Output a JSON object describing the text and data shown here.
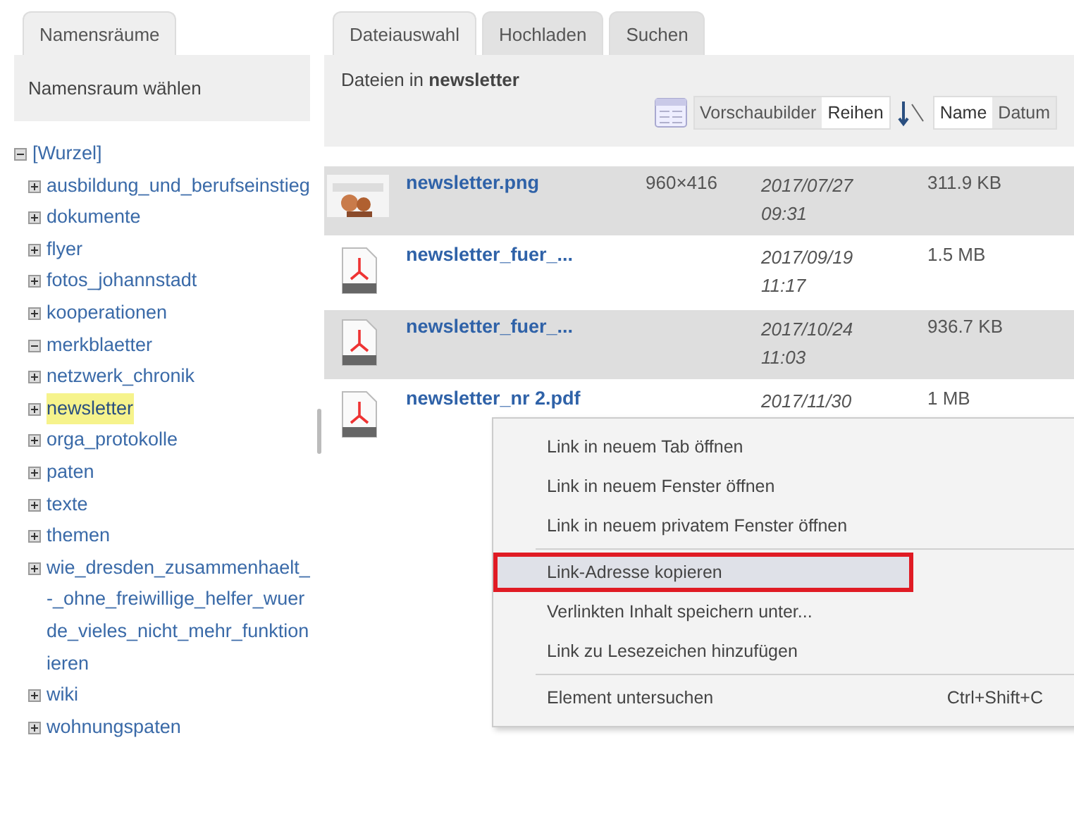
{
  "namespace_panel": {
    "tab": {
      "label": "Namensräume",
      "selected": true
    },
    "heading": "Namensraum wählen",
    "tree": [
      {
        "label": "[Wurzel]",
        "expanded": true,
        "selected": false,
        "children": [
          {
            "label": "ausbildung_und_berufseinstieg",
            "expanded": false,
            "selected": false
          },
          {
            "label": "dokumente",
            "expanded": false,
            "selected": false
          },
          {
            "label": "flyer",
            "expanded": false,
            "selected": false
          },
          {
            "label": "fotos_johannstadt",
            "expanded": false,
            "selected": false
          },
          {
            "label": "kooperationen",
            "expanded": false,
            "selected": false
          },
          {
            "label": "merkblaetter",
            "expanded": true,
            "selected": false
          },
          {
            "label": "netzwerk_chronik",
            "expanded": false,
            "selected": false
          },
          {
            "label": "newsletter",
            "expanded": false,
            "selected": true
          },
          {
            "label": "orga_protokolle",
            "expanded": false,
            "selected": false
          },
          {
            "label": "paten",
            "expanded": false,
            "selected": false
          },
          {
            "label": "texte",
            "expanded": false,
            "selected": false
          },
          {
            "label": "themen",
            "expanded": false,
            "selected": false
          },
          {
            "label": "wie_dresden_zusammenhaelt_-_ohne_freiwillige_helfer_wuerde_vieles_nicht_mehr_funktionieren",
            "expanded": false,
            "selected": false
          },
          {
            "label": "wiki",
            "expanded": false,
            "selected": false
          },
          {
            "label": "wohnungspaten",
            "expanded": false,
            "selected": false
          }
        ]
      }
    ]
  },
  "file_panel": {
    "tabs": [
      {
        "label": "Dateiauswahl",
        "selected": true
      },
      {
        "label": "Hochladen",
        "selected": false
      },
      {
        "label": "Suchen",
        "selected": false
      }
    ],
    "heading": "Dateien in **newsletter**",
    "view_toggle": [
      {
        "label": "Vorschaubilder",
        "selected": false
      },
      {
        "label": "Reihen",
        "selected": true
      }
    ],
    "sort_toggle": [
      {
        "label": "Name",
        "selected": true
      },
      {
        "label": "Datum",
        "selected": false
      }
    ],
    "files": [
      {
        "name": "newsletter.png",
        "dimensions": "960×416",
        "date": "2017/07/27",
        "time": "09:31",
        "size": "311.9 KB"
      },
      {
        "kind": "pdf",
        "name": "newsletter_fuer_...",
        "date": "2017/09/19",
        "time": "11:17",
        "size": "1.5 MB"
      },
      {
        "kind": "pdf",
        "name": "newsletter_fuer_...",
        "date": "2017/10/24",
        "time": "11:03",
        "size": "936.7 KB"
      },
      {
        "kind": "pdf",
        "name": "newsletter_nr 2.pdf",
        "date": "2017/11/30",
        "size": "1 MB"
      }
    ]
  },
  "context_menu": {
    "items": [
      {
        "kind": "item",
        "label": "Link in neuem Tab öffnen",
        "selected": false,
        "outlined": false
      },
      {
        "kind": "item",
        "label": "Link in neuem Fenster öffnen",
        "selected": false,
        "outlined": false
      },
      {
        "kind": "item",
        "label": "Link in neuem privatem Fenster öffnen",
        "selected": false,
        "outlined": false
      },
      {
        "kind": "separator"
      },
      {
        "kind": "item",
        "label": "Link-Adresse kopieren",
        "selected": true,
        "outlined": true
      },
      {
        "kind": "item",
        "label": "Verlinkten Inhalt speichern unter...",
        "selected": false,
        "outlined": false
      },
      {
        "kind": "item",
        "label": "Link zu Lesezeichen hinzufügen",
        "selected": false,
        "outlined": false
      },
      {
        "kind": "separator"
      },
      {
        "kind": "item",
        "label": "Element untersuchen",
        "shortcut": "Ctrl+Shift+C",
        "selected": false,
        "outlined": false
      }
    ]
  }
}
